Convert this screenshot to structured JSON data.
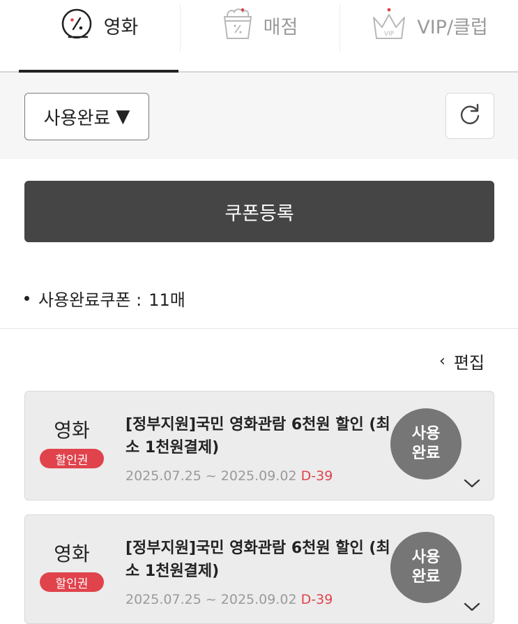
{
  "tabs": [
    {
      "label": "영화",
      "active": true,
      "icon": "movie-discount-icon"
    },
    {
      "label": "매점",
      "active": false,
      "icon": "snack-bucket-icon"
    },
    {
      "label": "VIP/클럽",
      "active": false,
      "icon": "vip-crown-icon"
    }
  ],
  "filter": {
    "selected": "사용완료",
    "arrow": "▼"
  },
  "register_button": "쿠폰등록",
  "summary": {
    "label": "사용완료쿠폰 :",
    "count": "11매"
  },
  "edit": {
    "chevron": "‹",
    "label": "편집"
  },
  "coupons": [
    {
      "category": "영화",
      "badge": "할인권",
      "title": "[정부지원]국민 영화관람 6천원 할인 (최소 1천원결제)",
      "date_range": "2025.07.25 ~ 2025.09.02",
      "dday": "D-39",
      "status_line1": "사용",
      "status_line2": "완료"
    },
    {
      "category": "영화",
      "badge": "할인권",
      "title": "[정부지원]국민 영화관람 6천원 할인 (최소 1천원결제)",
      "date_range": "2025.07.25 ~ 2025.09.02",
      "dday": "D-39",
      "status_line1": "사용",
      "status_line2": "완료"
    }
  ],
  "colors": {
    "accent_red": "#e0434c",
    "dark_button": "#454545",
    "status_grey": "#767676",
    "card_bg": "#ececec"
  }
}
